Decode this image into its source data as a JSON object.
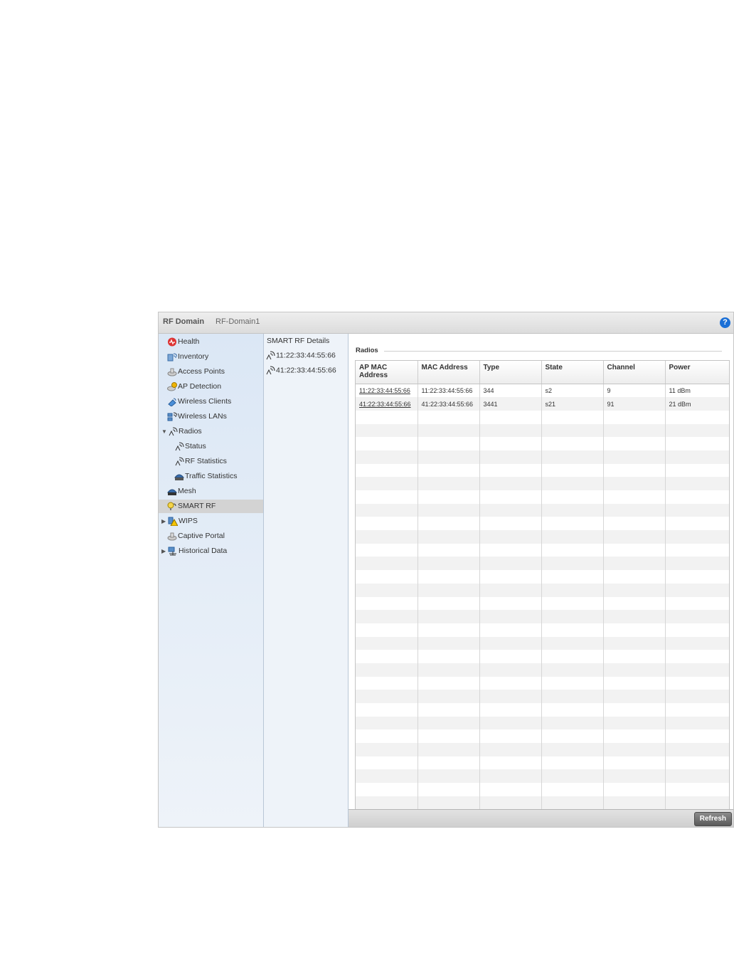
{
  "header": {
    "title": "RF Domain",
    "subtitle": "RF-Domain1",
    "help_label": "?"
  },
  "nav": {
    "items": [
      {
        "label": "Health",
        "icon": "health-icon"
      },
      {
        "label": "Inventory",
        "icon": "inventory-icon"
      },
      {
        "label": "Access Points",
        "icon": "access-points-icon"
      },
      {
        "label": "AP Detection",
        "icon": "ap-detection-icon"
      },
      {
        "label": "Wireless Clients",
        "icon": "wireless-clients-icon"
      },
      {
        "label": "Wireless LANs",
        "icon": "wireless-lans-icon"
      },
      {
        "label": "Radios",
        "icon": "radio-icon",
        "expanded": true
      },
      {
        "label": "Status",
        "icon": "radio-icon"
      },
      {
        "label": "RF Statistics",
        "icon": "radio-icon"
      },
      {
        "label": "Traffic Statistics",
        "icon": "traffic-icon"
      },
      {
        "label": "Mesh",
        "icon": "mesh-icon"
      },
      {
        "label": "SMART RF",
        "icon": "smart-rf-icon",
        "selected": true
      },
      {
        "label": "WIPS",
        "icon": "wips-icon",
        "collapsed": true
      },
      {
        "label": "Captive Portal",
        "icon": "captive-portal-icon"
      },
      {
        "label": "Historical Data",
        "icon": "historical-data-icon",
        "collapsed": true
      }
    ]
  },
  "details": {
    "header": "SMART RF Details",
    "items": [
      "11:22:33:44:55:66",
      "41:22:33:44:55:66"
    ]
  },
  "radios": {
    "section_label": "Radios",
    "columns": [
      "AP MAC Address",
      "MAC Address",
      "Type",
      "State",
      "Channel",
      "Power"
    ],
    "rows": [
      [
        "11:22:33:44:55:66",
        "11:22:33:44:55:66",
        "344",
        "s2",
        "9",
        "11 dBm"
      ],
      [
        "41:22:33:44:55:66",
        "41:22:33:44:55:66",
        "3441",
        "s21",
        "91",
        "21 dBm"
      ]
    ]
  },
  "footer": {
    "refresh_label": "Refresh"
  },
  "colors": {
    "nav_bg": "#dbe7f5",
    "selected_bg": "#d3d3d3",
    "accent": "#1a6fd6"
  }
}
